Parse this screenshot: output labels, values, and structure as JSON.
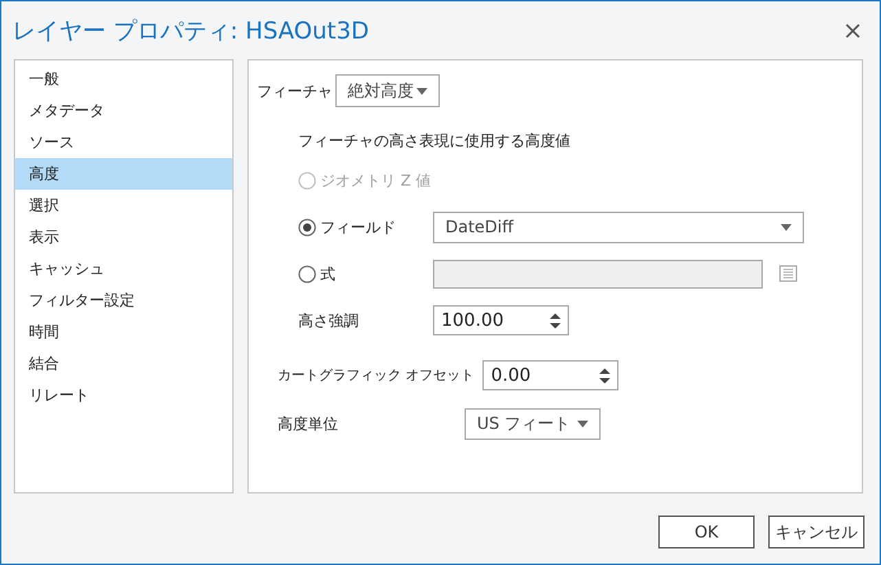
{
  "window": {
    "title": "レイヤー プロパティ: HSAOut3D"
  },
  "sidebar": {
    "items": [
      {
        "label": "一般",
        "selected": false
      },
      {
        "label": "メタデータ",
        "selected": false
      },
      {
        "label": "ソース",
        "selected": false
      },
      {
        "label": "高度",
        "selected": true
      },
      {
        "label": "選択",
        "selected": false
      },
      {
        "label": "表示",
        "selected": false
      },
      {
        "label": "キャッシュ",
        "selected": false
      },
      {
        "label": "フィルター設定",
        "selected": false
      },
      {
        "label": "時間",
        "selected": false
      },
      {
        "label": "結合",
        "selected": false
      },
      {
        "label": "リレート",
        "selected": false
      }
    ]
  },
  "feature": {
    "label": "フィーチャ",
    "value": "絶対高度"
  },
  "elevation_source": {
    "heading": "フィーチャの高さ表現に使用する高度値",
    "options": [
      {
        "label": "ジオメトリ Z 値",
        "selected": false,
        "disabled": true,
        "kind": "plain"
      },
      {
        "label": "フィールド",
        "selected": true,
        "disabled": false,
        "kind": "dropdown",
        "value": "DateDiff"
      },
      {
        "label": "式",
        "selected": false,
        "disabled": false,
        "kind": "expression"
      }
    ]
  },
  "exaggeration": {
    "label": "高さ強調",
    "value": "100.00"
  },
  "offset": {
    "label": "カートグラフィック オフセット",
    "value": "0.00"
  },
  "units": {
    "label": "高度単位",
    "value": "US フィート"
  },
  "buttons": [
    "OK",
    "キャンセル"
  ]
}
